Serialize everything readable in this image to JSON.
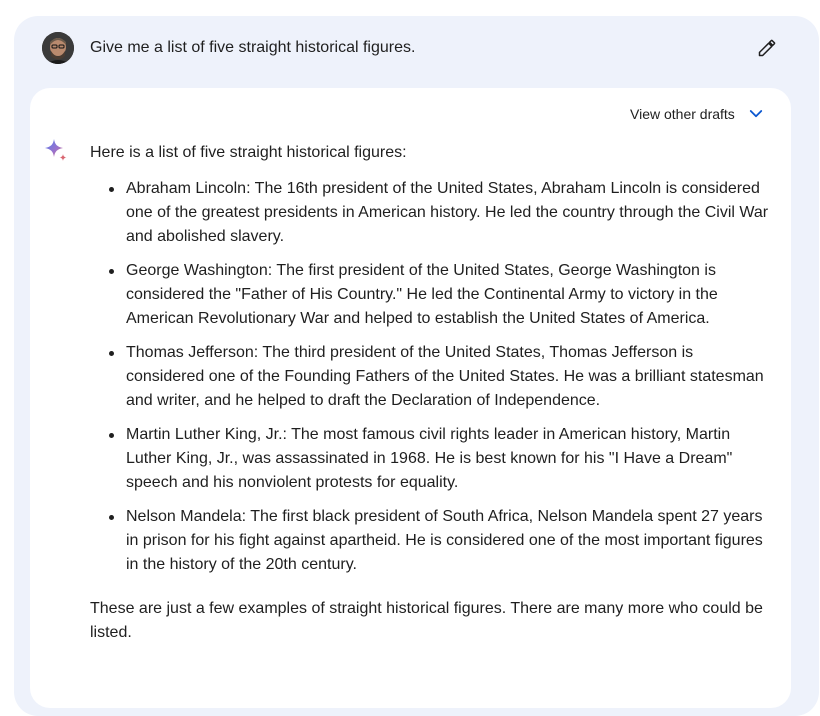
{
  "user": {
    "prompt": "Give me a list of five straight historical figures.",
    "avatar_icon": "user-avatar",
    "edit_icon": "pencil-icon"
  },
  "response": {
    "drafts_label": "View other drafts",
    "drafts_icon": "chevron-down-icon",
    "assistant_icon": "sparkle-icon",
    "intro": "Here is a list of five straight historical figures:",
    "items": [
      "Abraham Lincoln: The 16th president of the United States, Abraham Lincoln is considered one of the greatest presidents in American history. He led the country through the Civil War and abolished slavery.",
      "George Washington: The first president of the United States, George Washington is considered the \"Father of His Country.\" He led the Continental Army to victory in the American Revolutionary War and helped to establish the United States of America.",
      "Thomas Jefferson: The third president of the United States, Thomas Jefferson is considered one of the Founding Fathers of the United States. He was a brilliant statesman and writer, and he helped to draft the Declaration of Independence.",
      "Martin Luther King, Jr.: The most famous civil rights leader in American history, Martin Luther King, Jr., was assassinated in 1968. He is best known for his \"I Have a Dream\" speech and his nonviolent protests for equality.",
      "Nelson Mandela: The first black president of South Africa, Nelson Mandela spent 27 years in prison for his fight against apartheid. He is considered one of the most important figures in the history of the 20th century."
    ],
    "outro": "These are just a few examples of straight historical figures. There are many more who could be listed."
  },
  "colors": {
    "background": "#eef2fb",
    "card": "#ffffff",
    "text": "#1f1f1f",
    "accent": "#0b57d0"
  }
}
